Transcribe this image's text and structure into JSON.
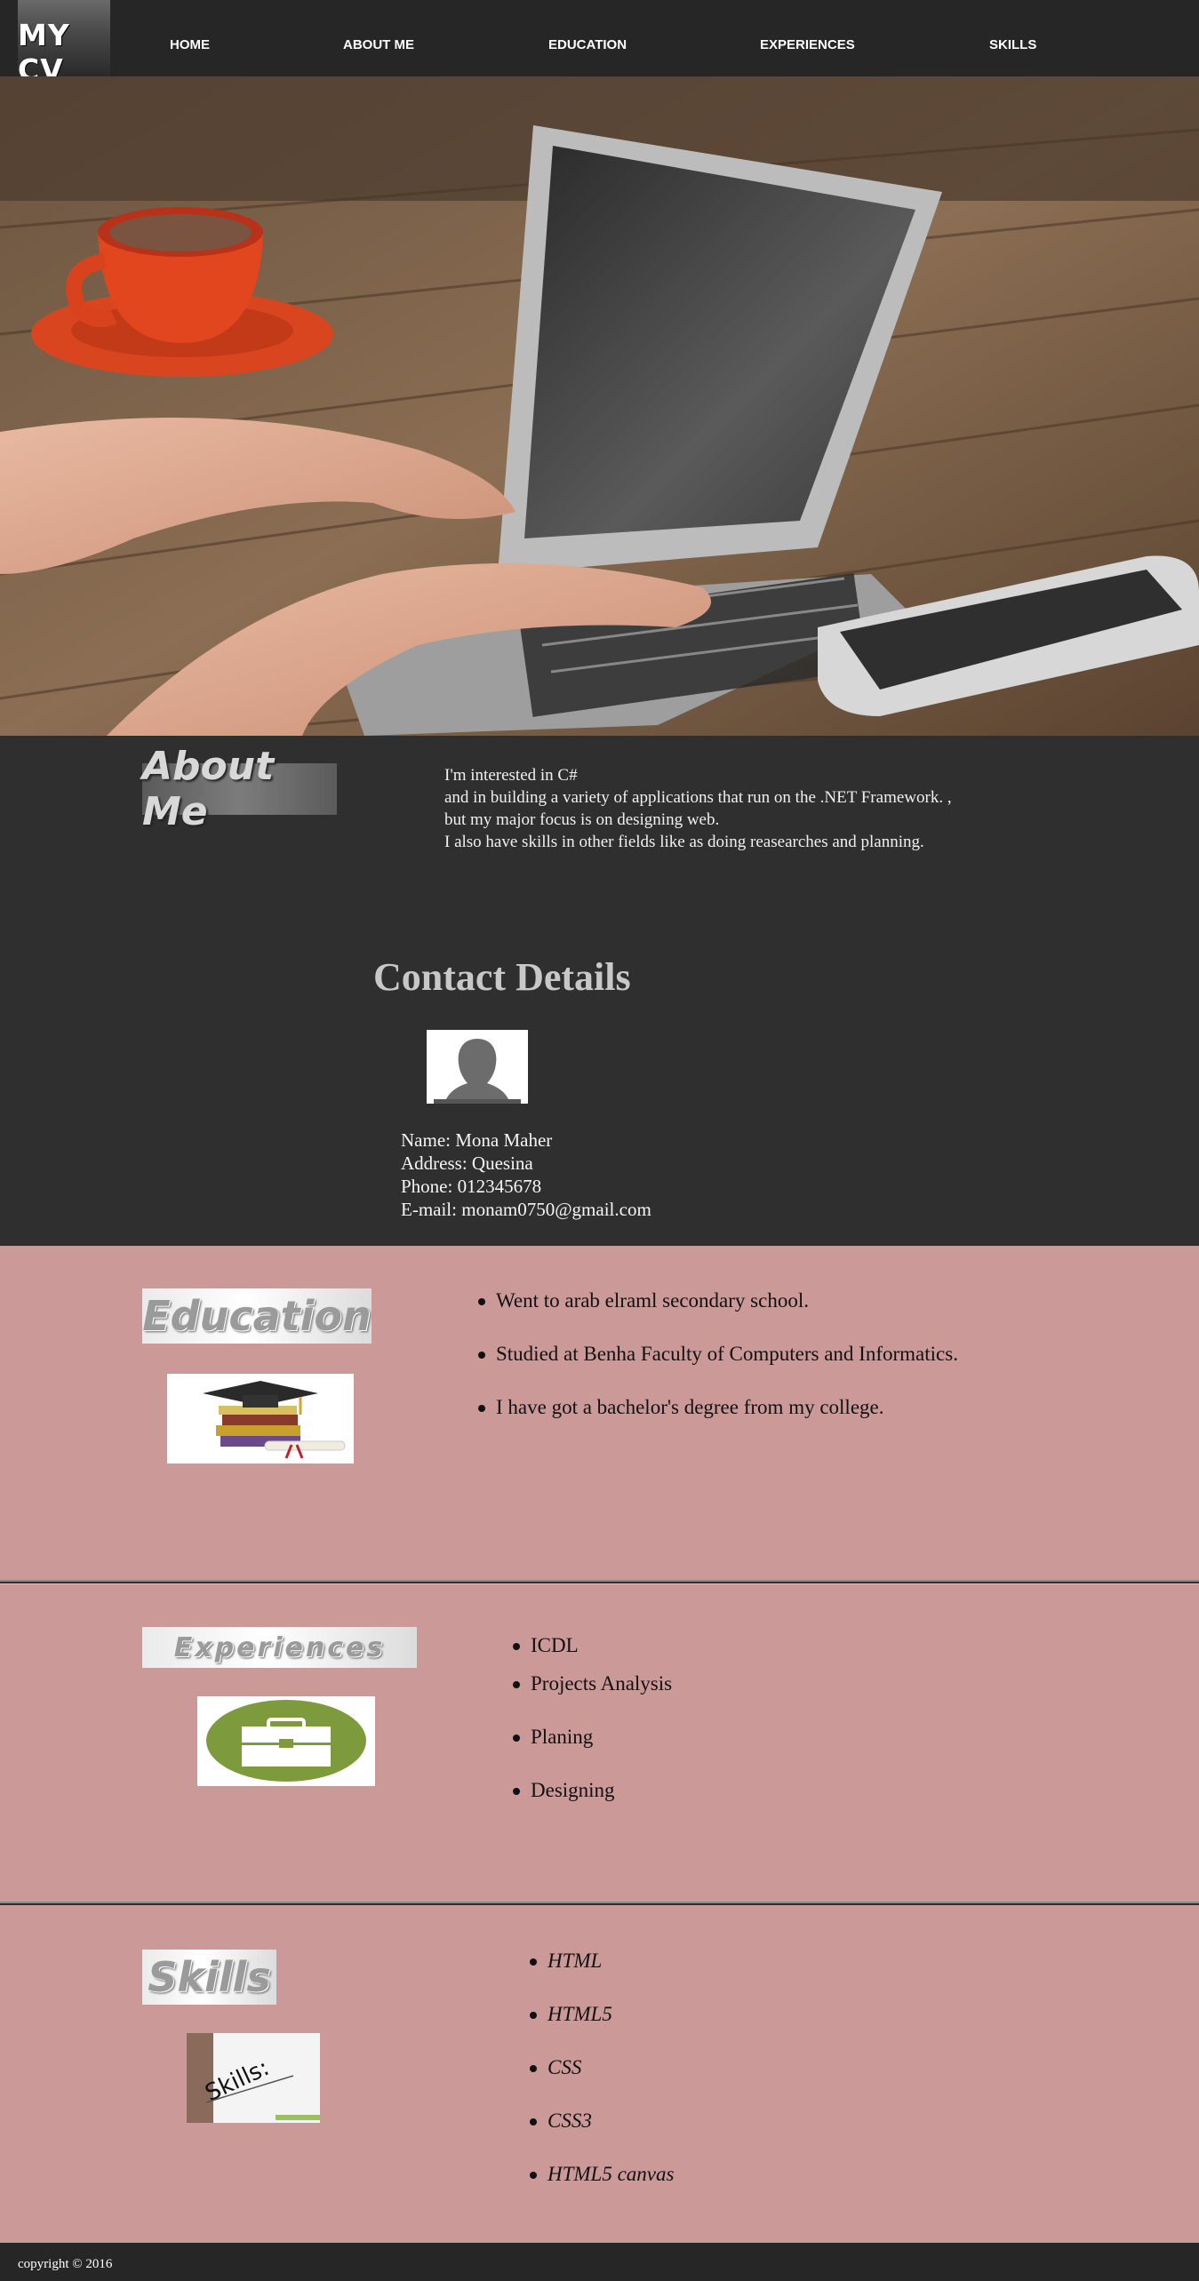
{
  "nav": {
    "logo": "MY CV",
    "links": [
      "HOME",
      "ABOUT ME",
      "EDUCATION",
      "EXPERIENCES",
      "SKILLS"
    ]
  },
  "about": {
    "heading": "About Me",
    "lines": [
      "I'm interested in C#",
      "and in building a variety of applications that run on the .NET Framework. ,",
      "but my major focus is on designing web.",
      "I also have skills in other fields like as doing reasearches and planning."
    ]
  },
  "contact": {
    "title": "Contact Details",
    "name": "Name: Mona Maher",
    "address": "Address: Quesina",
    "phone": "Phone: 012345678",
    "email": "E-mail: monam0750@gmail.com"
  },
  "education": {
    "heading": "Education",
    "items": [
      "Went to arab elraml secondary school.",
      "Studied at Benha Faculty of Computers and Informatics.",
      "I have got a bachelor's degree from my college."
    ]
  },
  "experiences": {
    "heading": "Experiences",
    "items": [
      "ICDL",
      "Projects Analysis",
      "Planing",
      "Designing"
    ]
  },
  "skills": {
    "heading": "Skills",
    "image_text": "Skills:",
    "items": [
      "HTML",
      "HTML5",
      "CSS",
      "CSS3",
      "HTML5 canvas"
    ]
  },
  "footer": {
    "copyright": "copyright © 2016"
  },
  "colors": {
    "nav_bg": "#262626",
    "dark_section": "#2f2f2f",
    "pink_section": "#cc9999"
  }
}
